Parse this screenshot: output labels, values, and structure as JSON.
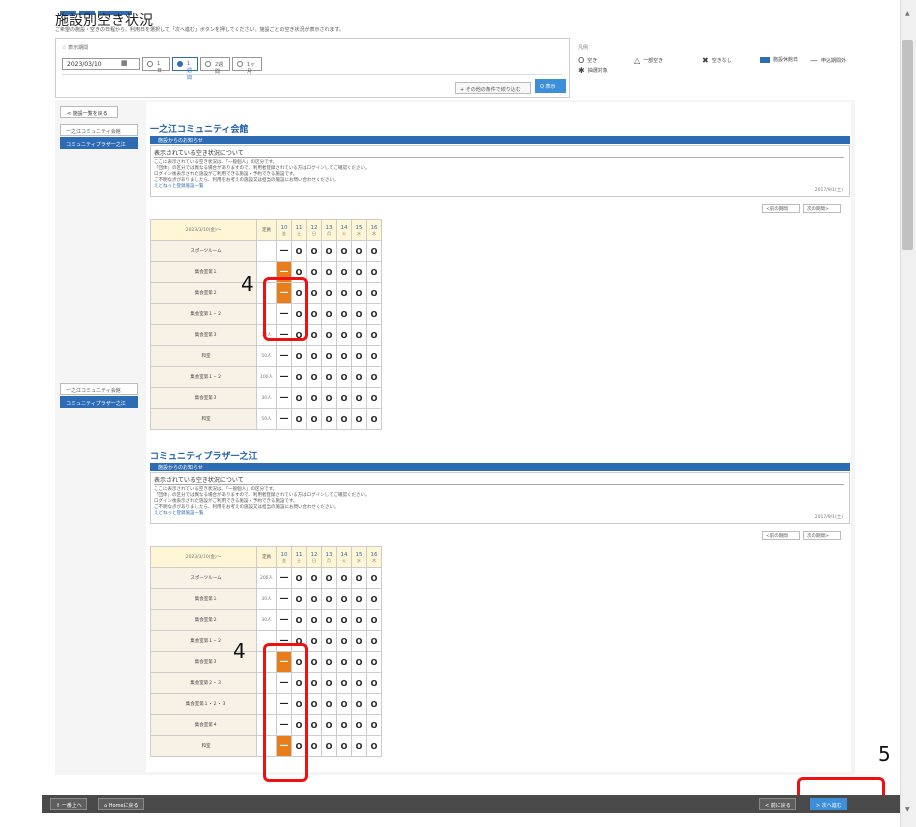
{
  "page": {
    "title": "施設別空き状況",
    "description": "ご希望の施設・空きの日程から、利用日を選択して「次へ進む」ボタンを押してください。施設ごとの空き状況が表示されます。"
  },
  "search": {
    "label": "☆ 表示期間",
    "date": "2023/03/10",
    "from": "から",
    "periods": [
      "1日",
      "1週間",
      "2週間",
      "1ヶ月"
    ],
    "selected_index": 1,
    "filter_btn": "その他の条件で絞り込む",
    "show_btn": "Q 表示"
  },
  "legend": {
    "title": "凡例",
    "items": [
      {
        "sym": "O",
        "text": "空き"
      },
      {
        "sym": "△",
        "text": "一部空き"
      },
      {
        "sym": "✖",
        "text": "空きなし"
      },
      {
        "sym": "box",
        "text": "施設休館日"
      },
      {
        "sym": "—",
        "text": "申込期間外"
      },
      {
        "sym": "✱",
        "text": "抽選対象"
      }
    ]
  },
  "sidebar": {
    "back": "< 施設一覧を戻る",
    "items": [
      "一之江コミュニティ会館",
      "コミュニティプラザ一之江"
    ],
    "active_index": 1
  },
  "facilities": [
    {
      "name": "一之江コミュニティ会館",
      "notice_bar": "施設からのお知らせ",
      "notice_head": "表示されている空き状況について",
      "notice_lines": [
        "ここに表示されている空き状況は、「一般個人」の区分です。",
        "「団体」の区分では異なる場合がありますので、利用者登録されている方はログインしてご確認ください。",
        "ログイン後表示された施設がご利用できる施設・予約できる施設です。",
        "ご不明な点がありましたら、利用をお考えの施設又は担当の施設にお問い合わせください。"
      ],
      "notice_link": "えどねっと登録施設一覧",
      "updated": "2017/9/1(土)",
      "prev": "<前の期間",
      "next": "次の期間>"
    },
    {
      "name": "コミュニティプラザ一之江",
      "notice_bar": "施設からのお知らせ",
      "notice_head": "表示されている空き状況について",
      "notice_lines": [
        "ここに表示されている空き状況は、「一般個人」の区分です。",
        "「団体」の区分では異なる場合がありますので、利用者登録されている方はログインしてご確認ください。",
        "ログイン後表示された施設がご利用できる施設・予約できる施設です。",
        "ご不明な点がありましたら、利用をお考えの施設又は担当の施設にお問い合わせください。"
      ],
      "notice_link": "えどねっと登録施設一覧",
      "updated": "2017/9/1(土)",
      "prev": "<前の期間",
      "next": "次の期間>"
    }
  ],
  "table_header": {
    "period": "2023/3/10(金)～",
    "cap": "定員",
    "days": [
      {
        "d": "10",
        "w": "金"
      },
      {
        "d": "11",
        "w": "土"
      },
      {
        "d": "12",
        "w": "日"
      },
      {
        "d": "13",
        "w": "月"
      },
      {
        "d": "14",
        "w": "火"
      },
      {
        "d": "15",
        "w": "水"
      },
      {
        "d": "16",
        "w": "木"
      }
    ]
  },
  "table1": [
    {
      "room": "スポーツルーム",
      "cap": "",
      "cells": [
        "—",
        "O",
        "O",
        "O",
        "O",
        "O",
        "O"
      ]
    },
    {
      "room": "集会室第１",
      "cap": "",
      "cells": [
        "—",
        "O",
        "O",
        "O",
        "O",
        "O",
        "O"
      ]
    },
    {
      "room": "集会室第２",
      "cap": "",
      "cells": [
        "—",
        "O",
        "O",
        "O",
        "O",
        "O",
        "O"
      ]
    },
    {
      "room": "集会室第１・２",
      "cap": "",
      "cells": [
        "—",
        "O",
        "O",
        "O",
        "O",
        "O",
        "O"
      ]
    },
    {
      "room": "集会室第３",
      "cap": "30人",
      "cells": [
        "—",
        "O",
        "O",
        "O",
        "O",
        "O",
        "O"
      ]
    },
    {
      "room": "和室",
      "cap": "50人",
      "cells": [
        "—",
        "O",
        "O",
        "O",
        "O",
        "O",
        "O"
      ]
    },
    {
      "room": "集会室第１・２",
      "cap": "100人",
      "cells": [
        "—",
        "O",
        "O",
        "O",
        "O",
        "O",
        "O"
      ]
    },
    {
      "room": "集会室第３",
      "cap": "30人",
      "cells": [
        "—",
        "O",
        "O",
        "O",
        "O",
        "O",
        "O"
      ]
    },
    {
      "room": "和室",
      "cap": "50人",
      "cells": [
        "—",
        "O",
        "O",
        "O",
        "O",
        "O",
        "O"
      ]
    }
  ],
  "table2": [
    {
      "room": "スポーツルーム",
      "cap": "200人",
      "cells": [
        "—",
        "O",
        "O",
        "O",
        "O",
        "O",
        "O"
      ]
    },
    {
      "room": "集会室第１",
      "cap": "30人",
      "cells": [
        "—",
        "O",
        "O",
        "O",
        "O",
        "O",
        "O"
      ]
    },
    {
      "room": "集会室第２",
      "cap": "30人",
      "cells": [
        "—",
        "O",
        "O",
        "O",
        "O",
        "O",
        "O"
      ]
    },
    {
      "room": "集会室第１・２",
      "cap": "",
      "cells": [
        "—",
        "O",
        "O",
        "O",
        "O",
        "O",
        "O"
      ]
    },
    {
      "room": "集会室第３",
      "cap": "",
      "cells": [
        "—",
        "O",
        "O",
        "O",
        "O",
        "O",
        "O"
      ]
    },
    {
      "room": "集会室第２・３",
      "cap": "",
      "cells": [
        "—",
        "O",
        "O",
        "O",
        "O",
        "O",
        "O"
      ]
    },
    {
      "room": "集会室第１・２・３",
      "cap": "",
      "cells": [
        "—",
        "O",
        "O",
        "O",
        "O",
        "O",
        "O"
      ]
    },
    {
      "room": "集会室第４",
      "cap": "",
      "cells": [
        "—",
        "O",
        "O",
        "O",
        "O",
        "O",
        "O"
      ]
    },
    {
      "room": "和室",
      "cap": "",
      "cells": [
        "—",
        "O",
        "O",
        "O",
        "O",
        "O",
        "O"
      ]
    }
  ],
  "markers": {
    "m1": "4",
    "m2": "4",
    "m3": "5"
  },
  "footer": {
    "top": "⇑ 一番上へ",
    "home": "⌂ Homeに戻る",
    "back": "< 前に戻る",
    "next": "> 次へ進む"
  }
}
